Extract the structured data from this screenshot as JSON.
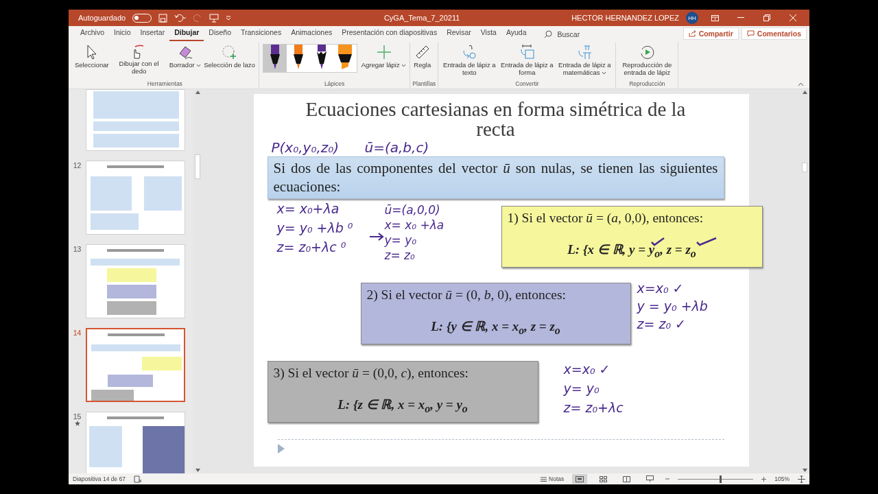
{
  "title_bar": {
    "autosave_label": "Autoguardado",
    "autosave_on": false,
    "document_title": "CyGA_Tema_7_20211",
    "user_name": "HECTOR HERNANDEZ LOPEZ",
    "user_initials": "HH"
  },
  "menu_tabs": [
    {
      "label": "Archivo",
      "selected": false
    },
    {
      "label": "Inicio",
      "selected": false
    },
    {
      "label": "Insertar",
      "selected": false
    },
    {
      "label": "Dibujar",
      "selected": true
    },
    {
      "label": "Diseño",
      "selected": false
    },
    {
      "label": "Transiciones",
      "selected": false
    },
    {
      "label": "Animaciones",
      "selected": false
    },
    {
      "label": "Presentación con diapositivas",
      "selected": false
    },
    {
      "label": "Revisar",
      "selected": false
    },
    {
      "label": "Vista",
      "selected": false
    },
    {
      "label": "Ayuda",
      "selected": false
    }
  ],
  "search": {
    "label": "Buscar"
  },
  "share_button": "Compartir",
  "comments_button": "Comentarios",
  "ribbon_groups": [
    {
      "name": "Herramientas",
      "items": [
        {
          "kind": "select",
          "label": "Seleccionar",
          "has_menu": false
        },
        {
          "kind": "finger",
          "label": "Dibujar con el dedo",
          "has_menu": false
        },
        {
          "kind": "eraser",
          "label": "Borrador",
          "has_menu": true
        },
        {
          "kind": "lasso",
          "label": "Selección de lazo",
          "has_menu": false
        }
      ]
    },
    {
      "name": "Lápices",
      "pens": [
        {
          "kind": "pen",
          "color": "#5b2d90",
          "selected": true
        },
        {
          "kind": "pen",
          "color": "#f07c1a",
          "selected": false
        },
        {
          "kind": "pencil",
          "color": "#5b2d90",
          "selected": false
        },
        {
          "kind": "highlighter",
          "color": "#f7941d",
          "selected": false
        }
      ],
      "items": [
        {
          "kind": "add",
          "label": "Agregar lápiz",
          "has_menu": true
        }
      ]
    },
    {
      "name": "Plantillas",
      "items": [
        {
          "kind": "ruler",
          "label": "Regla",
          "has_menu": false
        }
      ]
    },
    {
      "name": "Convertir",
      "items": [
        {
          "kind": "to-text",
          "label": "Entrada de lápiz a texto",
          "has_menu": false
        },
        {
          "kind": "to-shape",
          "label": "Entrada de lápiz a forma",
          "has_menu": false
        },
        {
          "kind": "to-math",
          "label": "Entrada de lápiz a matemáticas",
          "has_menu": true
        }
      ]
    },
    {
      "name": "Reproducción",
      "items": [
        {
          "kind": "replay",
          "label": "Reproducción de entrada de lápiz",
          "has_menu": false
        }
      ]
    }
  ],
  "slides": [
    {
      "selected": false
    },
    {
      "number": "12",
      "selected": false
    },
    {
      "number": "13",
      "selected": false
    },
    {
      "number": "14",
      "selected": true
    },
    {
      "number": "15",
      "selected": false,
      "has_animation": true
    }
  ],
  "slide": {
    "title": "Ecuaciones cartesianas en forma simétrica de la recta",
    "intro": "Si dos de las componentes del vector *ū* son nulas, se tienen las siguientes ecuaciones:",
    "cases": [
      {
        "color": "#f6f69c",
        "heading": "1) Si el vector *ū* = (*a*, 0,0), entonces:",
        "equation": "L: {x ∈ ℝ, y = y$_{o}$, z = z$_{o}$"
      },
      {
        "color": "#b3b7dc",
        "heading": "2) Si el vector *ū* = (0, *b*, 0), entonces:",
        "equation": "L: {y ∈ ℝ, x = x$_{o}$, z = z$_{o}$"
      },
      {
        "color": "#b2b2b2",
        "heading": "3) Si el vector *ū* = (0,0, *c*), entonces:",
        "equation": "L: {z ∈ ℝ, x = x$_{o}$, y = y$_{o}$"
      }
    ]
  },
  "ink": {
    "point": "P(x₀,y₀,z₀)",
    "vector": "ū=(a,b,c)",
    "blocks": [
      {
        "lines": [
          "x= x₀+λa",
          "y= y₀ +λb ⁰",
          "z= z₀+λc ⁰"
        ]
      },
      {
        "lines": [
          "ū=(a,0,0)",
          "x= x₀ +λa",
          "y= y₀",
          "z= z₀"
        ]
      },
      {
        "lines": [
          "x=x₀ ✓",
          "y = y₀ +λb",
          "z= z₀ ✓"
        ]
      },
      {
        "lines": [
          "x=x₀ ✓",
          "y= y₀",
          "z= z₀+λc"
        ]
      }
    ]
  },
  "status_bar": {
    "slide_info": "Diapositiva 14 de 67",
    "notes_label": "Notas",
    "zoom_slider": {
      "level": 0.55
    },
    "zoom_text": "105%"
  }
}
